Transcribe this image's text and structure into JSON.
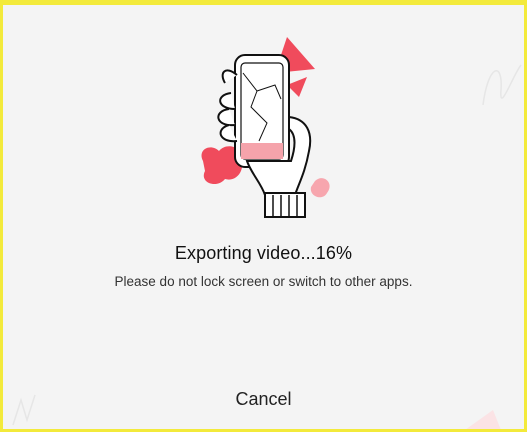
{
  "export_dialog": {
    "illustration_icon": "hand-holding-phone-illustration",
    "title": "Exporting video...16%",
    "progress_percent": 16,
    "subtitle": "Please do not lock screen or switch to other apps.",
    "cancel_label": "Cancel"
  },
  "colors": {
    "accent": "#f04b5c",
    "accent_light": "#f7a6ae",
    "frame": "#f3ea3b",
    "background": "#f4f4f4"
  }
}
